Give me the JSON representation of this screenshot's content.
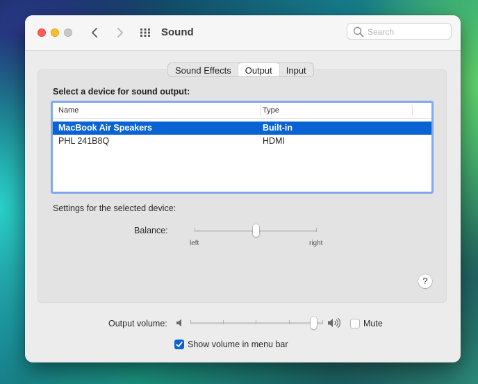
{
  "window": {
    "title": "Sound",
    "search_placeholder": "Search"
  },
  "tabs": [
    {
      "label": "Sound Effects",
      "active": false
    },
    {
      "label": "Output",
      "active": true
    },
    {
      "label": "Input",
      "active": false
    }
  ],
  "output": {
    "section_title": "Select a device for sound output:",
    "columns": [
      "Name",
      "Type"
    ],
    "devices": [
      {
        "name": "MacBook Air Speakers",
        "type": "Built-in",
        "selected": true
      },
      {
        "name": "PHL 241B8Q",
        "type": "HDMI",
        "selected": false
      }
    ],
    "settings_label": "Settings for the selected device:",
    "balance": {
      "label": "Balance:",
      "left_label": "left",
      "right_label": "right",
      "value": 0.5
    }
  },
  "help_label": "?",
  "volume": {
    "label": "Output volume:",
    "value": 0.93,
    "mute_label": "Mute",
    "muted": false
  },
  "menu_bar": {
    "label": "Show volume in menu bar",
    "checked": true
  },
  "colors": {
    "accent": "#0a63d3",
    "close": "#ff5f57",
    "minimize": "#febc2e",
    "maximize_disabled": "#c9c9c9",
    "table_focus_ring": "#80a8ee"
  },
  "icons": [
    "back-arrow-icon",
    "forward-arrow-icon",
    "grid-icon",
    "search-icon",
    "speaker-low-icon",
    "speaker-high-icon",
    "checkmark-icon"
  ]
}
